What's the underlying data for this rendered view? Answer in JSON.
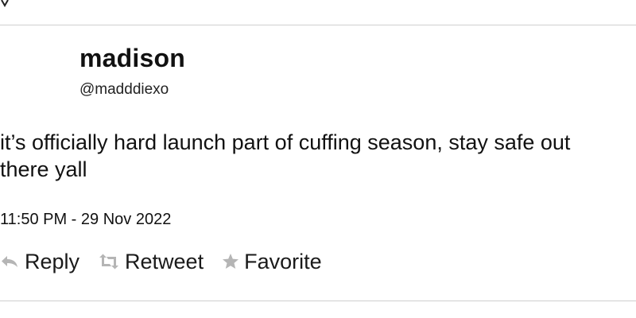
{
  "tweet": {
    "display_name": "madison",
    "handle": "@madddiexo",
    "text": "it’s officially hard launch part of cuffing season, stay safe out there yall",
    "timestamp": "11:50 PM - 29 Nov 2022"
  },
  "actions": {
    "reply_label": "Reply",
    "retweet_label": "Retweet",
    "favorite_label": "Favorite",
    "reply_icon": "reply-arrow-icon",
    "retweet_icon": "retweet-icon",
    "favorite_icon": "star-icon"
  },
  "colors": {
    "icon_gray": "#b5b5b5",
    "divider": "#cfcfcf",
    "text": "#111111"
  }
}
